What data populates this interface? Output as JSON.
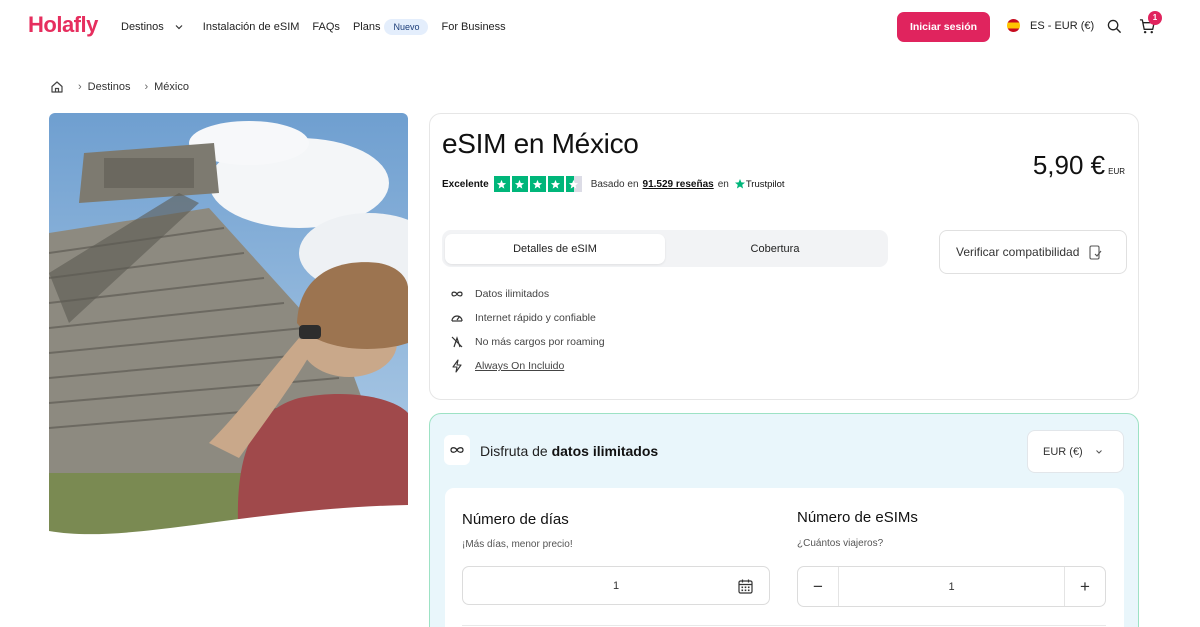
{
  "header": {
    "logo": "Holafly",
    "nav": [
      {
        "label": "Destinos"
      },
      {
        "label": "Instalación de eSIM"
      },
      {
        "label": "FAQs"
      },
      {
        "label": "Plans",
        "badge": "Nuevo"
      },
      {
        "label": "For Business"
      }
    ],
    "login_label": "Iniciar sesión",
    "locale_label": "ES - EUR (€)",
    "cart_count": "1",
    "brand_color": "#e0245e"
  },
  "breadcrumb": {
    "items": [
      "Destinos",
      "México"
    ]
  },
  "product": {
    "title": "eSIM en México",
    "rating_label": "Excelente",
    "rating_value": 4.5,
    "reviews_prefix": "Basado en",
    "reviews_count": "91.529 reseñas",
    "reviews_suffix": "en",
    "trustpilot": "Trustpilot",
    "price": "5,90 €",
    "price_currency": "EUR",
    "tabs": [
      "Detalles de eSIM",
      "Cobertura"
    ],
    "compat_label": "Verificar compatibilidad",
    "features": [
      {
        "icon": "infinity-icon",
        "label": "Datos ilimitados"
      },
      {
        "icon": "speedometer-icon",
        "label": "Internet rápido y confiable"
      },
      {
        "icon": "no-roaming-icon",
        "label": "No más cargos por roaming"
      },
      {
        "icon": "lightning-icon",
        "label": "Always On Incluido"
      }
    ]
  },
  "plan": {
    "title_prefix": "Disfruta de",
    "title_bold": "datos ilimitados",
    "currency_select": "EUR (€)",
    "days_title": "Número de días",
    "days_sub": "¡Más días, menor precio!",
    "days_value": "1",
    "esims_title": "Número de eSIMs",
    "esims_sub": "¿Cuántos viajeros?",
    "esims_value": "1",
    "minus": "−",
    "plus": "+"
  }
}
